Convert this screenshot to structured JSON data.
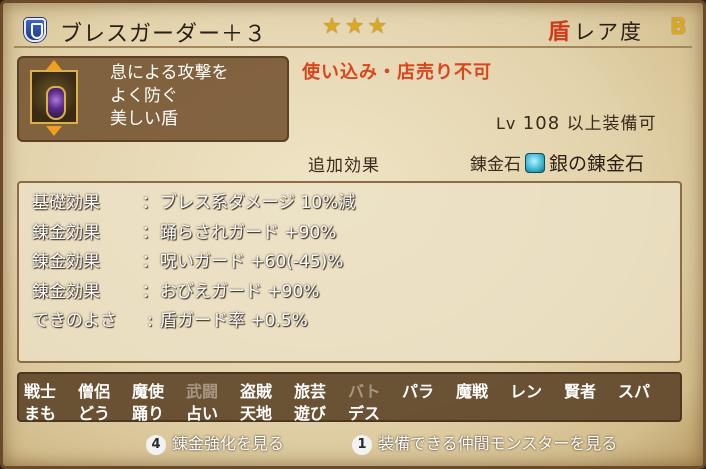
{
  "header": {
    "item_name": "ブレスガーダー＋３",
    "stars": "★★★",
    "rarity_icon": "盾",
    "rarity_label": "レア度",
    "rarity_value": "B"
  },
  "description": {
    "lines": [
      "息による攻撃を",
      "よく防ぐ",
      "美しい盾"
    ]
  },
  "restriction": "使い込み・店売り不可",
  "level": {
    "prefix": "Lv",
    "value": "108",
    "suffix": "以上装備可"
  },
  "section": {
    "effects_label": "追加効果",
    "alchemy_label": "錬金石",
    "alchemy_stone": "銀の錬金石"
  },
  "effects": [
    {
      "label": "基礎効果",
      "sep": "：",
      "value": "ブレス系ダメージ 10%減"
    },
    {
      "label": "錬金効果",
      "sep": "：",
      "value": "踊らされガード +90%"
    },
    {
      "label": "錬金効果",
      "sep": "：",
      "value": "呪いガード +60(-45)%"
    },
    {
      "label": "錬金効果",
      "sep": "：",
      "value": "おびえガード +90%"
    },
    {
      "label": "できのよさ",
      "sep": ":",
      "value": "盾ガード率 +0.5%"
    }
  ],
  "vocations": {
    "row1": [
      {
        "name": "戦士",
        "enabled": true
      },
      {
        "name": "僧侶",
        "enabled": true
      },
      {
        "name": "魔使",
        "enabled": true
      },
      {
        "name": "武闘",
        "enabled": false
      },
      {
        "name": "盗賊",
        "enabled": true
      },
      {
        "name": "旅芸",
        "enabled": true
      },
      {
        "name": "バト",
        "enabled": false
      },
      {
        "name": "パラ",
        "enabled": true
      },
      {
        "name": "魔戦",
        "enabled": true
      },
      {
        "name": "レン",
        "enabled": true
      },
      {
        "name": "賢者",
        "enabled": true
      },
      {
        "name": "スパ",
        "enabled": true
      }
    ],
    "row2": [
      {
        "name": "まも",
        "enabled": true
      },
      {
        "name": "どう",
        "enabled": true
      },
      {
        "name": "踊り",
        "enabled": true
      },
      {
        "name": "占い",
        "enabled": true
      },
      {
        "name": "天地",
        "enabled": true
      },
      {
        "name": "遊び",
        "enabled": true
      },
      {
        "name": "デス",
        "enabled": true
      }
    ]
  },
  "footer": {
    "btn4_key": "4",
    "btn4_label": "錬金強化を見る",
    "btn1_key": "1",
    "btn1_label": "装備できる仲間モンスターを見る"
  },
  "colors": {
    "restriction": "#d9461e",
    "stars": "#d9a925",
    "vocation_disabled": "#a69682"
  },
  "icons": {
    "header": "shield-category-icon",
    "item": "breath-guarder-shield-icon",
    "stone": "silver-alchemy-stone-icon"
  }
}
